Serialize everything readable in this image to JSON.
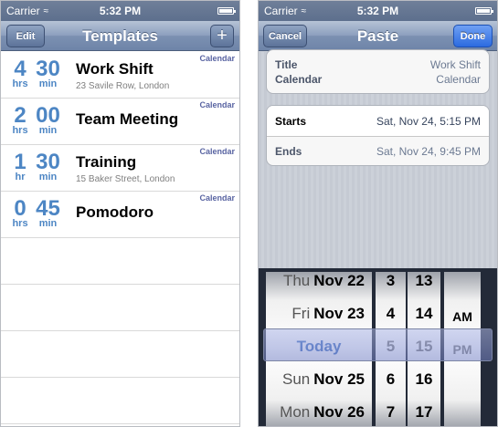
{
  "left": {
    "status": {
      "carrier": "Carrier",
      "time": "5:32 PM"
    },
    "nav": {
      "title": "Templates",
      "edit_label": "Edit",
      "add_label": "+"
    },
    "templates": [
      {
        "hours": "4",
        "mins": "30",
        "hours_unit": "hrs",
        "mins_unit": "min",
        "name": "Work Shift",
        "address": "23 Savile Row, London",
        "calendar": "Calendar"
      },
      {
        "hours": "2",
        "mins": "00",
        "hours_unit": "hrs",
        "mins_unit": "min",
        "name": "Team Meeting",
        "address": "",
        "calendar": "Calendar"
      },
      {
        "hours": "1",
        "mins": "30",
        "hours_unit": "hr",
        "mins_unit": "min",
        "name": "Training",
        "address": "15 Baker Street, London",
        "calendar": "Calendar"
      },
      {
        "hours": "0",
        "mins": "45",
        "hours_unit": "hrs",
        "mins_unit": "min",
        "name": "Pomodoro",
        "address": "",
        "calendar": "Calendar"
      }
    ]
  },
  "right": {
    "status": {
      "carrier": "Carrier",
      "time": "5:32 PM"
    },
    "nav": {
      "title": "Paste",
      "cancel_label": "Cancel",
      "done_label": "Done"
    },
    "info": {
      "title_label": "Title",
      "title_value": "Work Shift",
      "calendar_label": "Calendar",
      "calendar_value": "Calendar"
    },
    "times": {
      "starts_label": "Starts",
      "starts_value": "Sat, Nov 24, 5:15 PM",
      "ends_label": "Ends",
      "ends_value": "Sat, Nov 24, 9:45 PM"
    },
    "picker": {
      "dates": [
        {
          "weekday": "Thu",
          "date": "Nov 22"
        },
        {
          "weekday": "Fri",
          "date": "Nov 23"
        },
        {
          "weekday": "",
          "date": "Today"
        },
        {
          "weekday": "Sun",
          "date": "Nov 25"
        },
        {
          "weekday": "Mon",
          "date": "Nov 26"
        }
      ],
      "hours": [
        "3",
        "4",
        "5",
        "6",
        "7"
      ],
      "minutes": [
        "13",
        "14",
        "15",
        "16",
        "17"
      ],
      "ampm": [
        "AM",
        "PM"
      ]
    }
  }
}
